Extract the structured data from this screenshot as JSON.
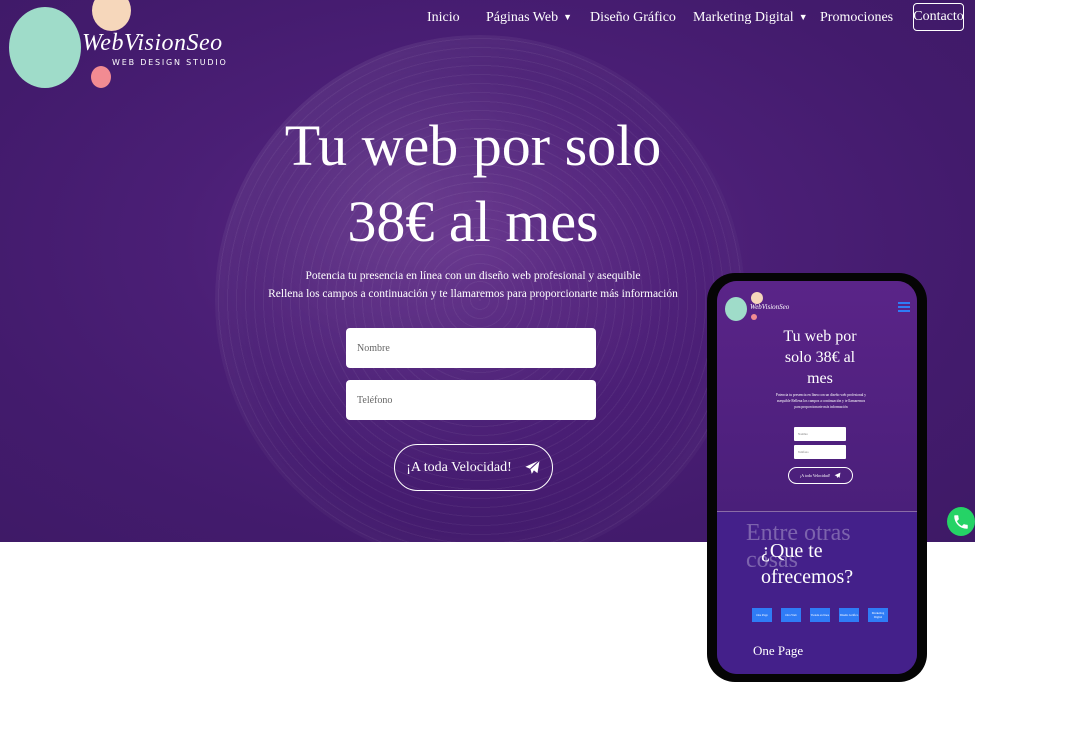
{
  "logo": {
    "script": "WebVisionSeo",
    "tagline": "WEB DESIGN STUDIO"
  },
  "nav": {
    "inicio": "Inicio",
    "paginas_web": "Páginas Web",
    "diseno_grafico": "Diseño Gráfico",
    "marketing_digital": "Marketing Digital",
    "promociones": "Promociones",
    "contacto": "Contacto"
  },
  "hero": {
    "title_line1": "Tu web por solo",
    "title_line2": "38€ al mes",
    "subtitle_line1": "Potencia tu presencia en línea con un diseño web profesional y asequible",
    "subtitle_line2": "Rellena los campos a continuación y te llamaremos para proporcionarte más información",
    "nombre_placeholder": "Nombre",
    "telefono_placeholder": "Teléfono",
    "submit_label": "¡A toda Velocidad!"
  },
  "phone": {
    "title": "Tu web por solo 38€ al mes",
    "subtitle": "Potencia tu presencia en línea con un diseño web profesional y asequible Rellena los campos a continuación y te llamaremos para proporcionarte más información",
    "nombre": "Nombre",
    "telefono": "Teléfono",
    "submit": "¡A toda Velocidad!",
    "ghost_text": "Entre otras cosas",
    "section_title": "¿Que te ofrecemos?",
    "tabs": [
      "One Page",
      "Otra Web",
      "Tienda en línea",
      "Diseño Gráfico",
      "Marketing Digital"
    ],
    "first_item": "One Page"
  },
  "colors": {
    "hero_bg": "#4b1f76",
    "accent_green": "#9fdcc9",
    "accent_peach": "#f6d7bb",
    "accent_pink": "#f28b92",
    "tab_blue": "#2f7cf6",
    "whatsapp": "#25d366"
  },
  "icons": {
    "submit": "paper-plane-icon",
    "floating": "whatsapp-icon",
    "dropdown": "chevron-down-icon",
    "mobile_menu": "hamburger-icon"
  }
}
